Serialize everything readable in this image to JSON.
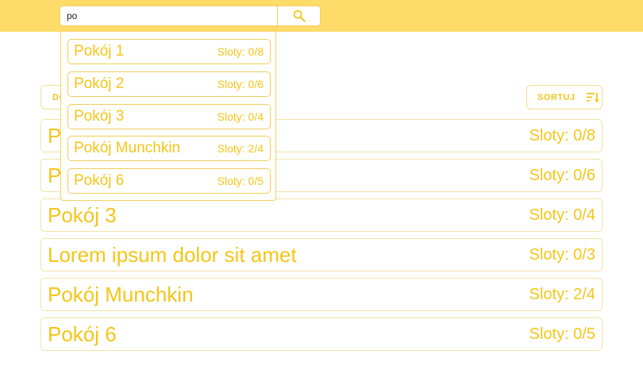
{
  "search": {
    "value": "po",
    "placeholder": ""
  },
  "suggestions": [
    {
      "name": "Pokój 1",
      "slots": "Sloty: 0/8"
    },
    {
      "name": "Pokój 2",
      "slots": "Sloty: 0/6"
    },
    {
      "name": "Pokój 3",
      "slots": "Sloty: 0/4"
    },
    {
      "name": "Pokój Munchkin",
      "slots": "Sloty: 2/4"
    },
    {
      "name": "Pokój 6",
      "slots": "Sloty: 0/5"
    }
  ],
  "toolbar": {
    "add_label": "DO",
    "sort_label": "SORTUJ"
  },
  "rooms": [
    {
      "name": "Pokój 1",
      "slots": "Sloty: 0/8"
    },
    {
      "name": "Pokój 2",
      "slots": "Sloty: 0/6"
    },
    {
      "name": "Pokój 3",
      "slots": "Sloty: 0/4"
    },
    {
      "name": "Lorem ipsum dolor sit amet",
      "slots": "Sloty: 0/3"
    },
    {
      "name": "Pokój Munchkin",
      "slots": "Sloty: 2/4"
    },
    {
      "name": "Pokój 6",
      "slots": "Sloty: 0/5"
    }
  ],
  "icons": {
    "search": "search-icon",
    "sort": "sort-icon"
  },
  "colors": {
    "topbar": "#ffdb6a",
    "accent": "#f5c518",
    "border": "#f5e2a6"
  }
}
